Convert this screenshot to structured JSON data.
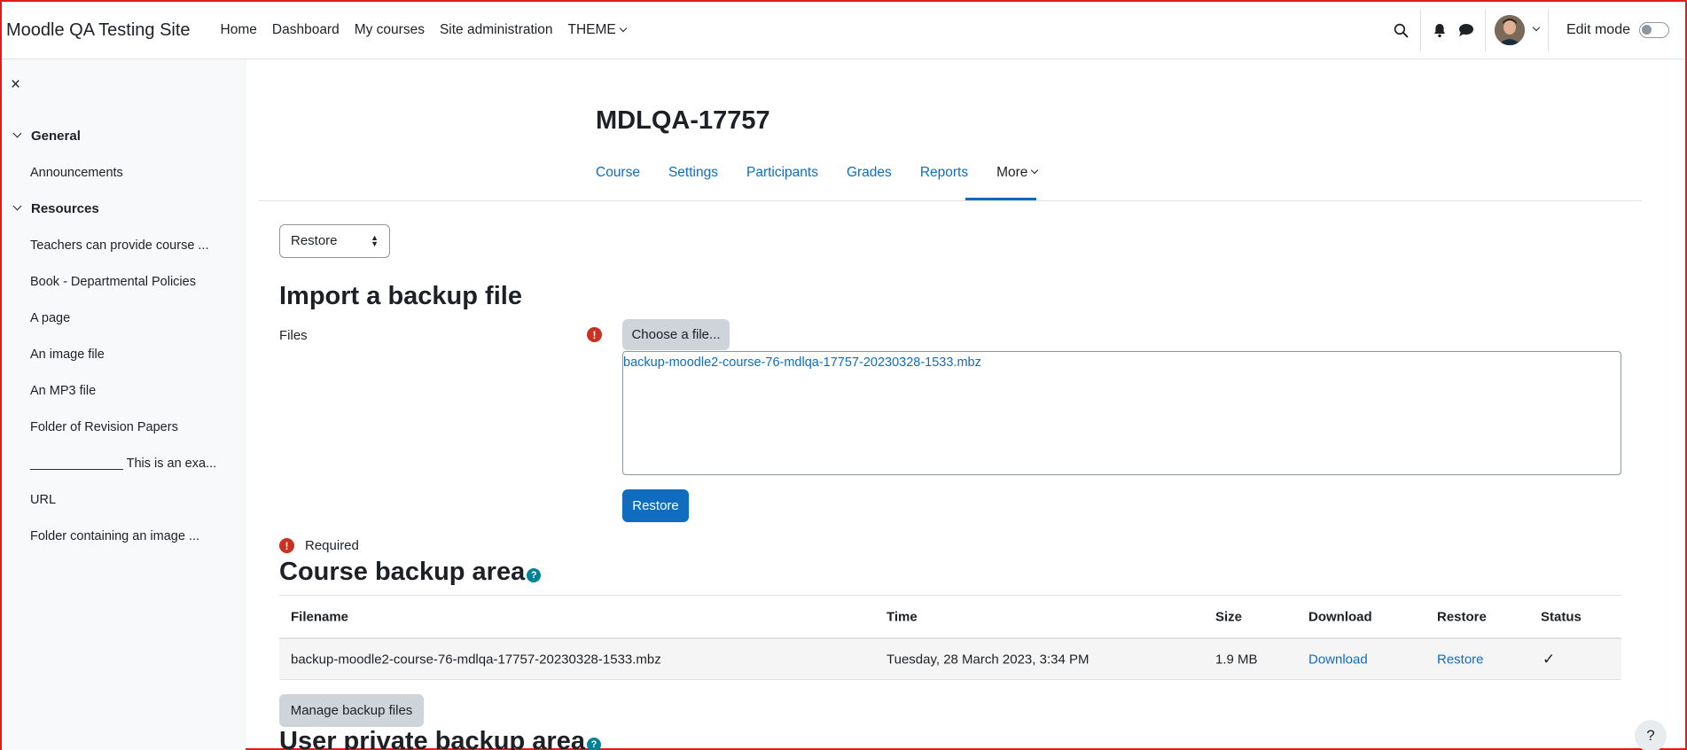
{
  "navbar": {
    "brand": "Moodle QA Testing Site",
    "items": [
      "Home",
      "Dashboard",
      "My courses",
      "Site administration",
      "THEME"
    ],
    "edit_mode_label": "Edit mode"
  },
  "drawer": {
    "close_symbol": "×",
    "sections": [
      {
        "label": "General",
        "items": [
          "Announcements"
        ]
      },
      {
        "label": "Resources",
        "items": [
          "Teachers can provide course ...",
          "Book - Departmental Policies",
          "A page",
          "An image file",
          "An MP3 file",
          "Folder of Revision Papers",
          "_____________ This is an exa...",
          "URL",
          "Folder containing an image ..."
        ]
      }
    ]
  },
  "course": {
    "title": "MDLQA-17757",
    "tabs": [
      "Course",
      "Settings",
      "Participants",
      "Grades",
      "Reports",
      "More"
    ]
  },
  "action_select": {
    "selected": "Restore"
  },
  "import": {
    "heading": "Import a backup file",
    "files_label": "Files",
    "choose_button": "Choose a file...",
    "selected_file": "backup-moodle2-course-76-mdlqa-17757-20230328-1533.mbz",
    "restore_button": "Restore",
    "required_label": "Required",
    "required_symbol": "!"
  },
  "backup_area": {
    "heading": "Course backup area",
    "help_symbol": "?",
    "columns": [
      "Filename",
      "Time",
      "Size",
      "Download",
      "Restore",
      "Status"
    ],
    "rows": [
      {
        "filename": "backup-moodle2-course-76-mdlqa-17757-20230328-1533.mbz",
        "time": "Tuesday, 28 March 2023, 3:34 PM",
        "size": "1.9 MB",
        "download": "Download",
        "restore": "Restore",
        "status": "✓"
      }
    ],
    "manage_button": "Manage backup files"
  },
  "private_area": {
    "heading": "User private backup area"
  },
  "help_fab": "?",
  "colors": {
    "primary": "#0f6cbf",
    "danger": "#ca3120",
    "info": "#008196"
  }
}
